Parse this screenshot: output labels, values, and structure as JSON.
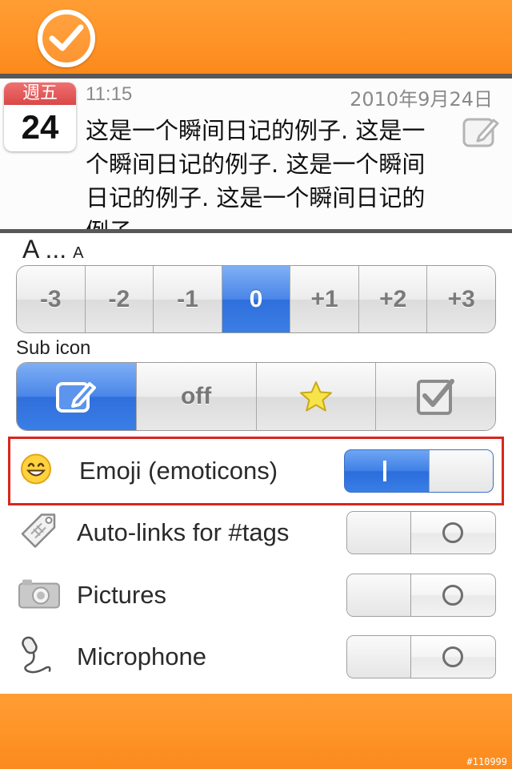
{
  "colors": {
    "accent_orange": "#ff9428",
    "toggle_on_blue": "#3f80e6",
    "highlight_red": "#d9261c"
  },
  "top_bar": {
    "icon": "checkmark-circle-icon"
  },
  "entry": {
    "calendar_weekday": "週五",
    "calendar_day": "24",
    "time": "11:15",
    "date": "2010年9月24日",
    "text": "这是一个瞬间日记的例子. 这是一个瞬间日记的例子. 这是一个瞬间日记的例子. 这是一个瞬间日记的例子.",
    "edit_icon": "edit-note-icon"
  },
  "font_size": {
    "label_large": "A ...",
    "label_small": "A",
    "options": [
      "-3",
      "-2",
      "-1",
      "0",
      "+1",
      "+2",
      "+3"
    ],
    "selected": "0"
  },
  "sub_icon": {
    "label": "Sub icon",
    "options": [
      {
        "icon": "edit-note-icon",
        "label": ""
      },
      {
        "icon": "",
        "label": "off"
      },
      {
        "icon": "star-icon",
        "label": ""
      },
      {
        "icon": "checkbox-icon",
        "label": ""
      }
    ],
    "selected_index": 0
  },
  "options": [
    {
      "icon": "emoji-smile-icon",
      "label": "Emoji (emoticons)",
      "state": "on",
      "highlighted": true
    },
    {
      "icon": "tag-icon",
      "label": "Auto-links for #tags",
      "state": "off",
      "highlighted": false
    },
    {
      "icon": "camera-icon",
      "label": "Pictures",
      "state": "off",
      "highlighted": false
    },
    {
      "icon": "microphone-icon",
      "label": "Microphone",
      "state": "off",
      "highlighted": false
    }
  ],
  "watermark": "#110999"
}
